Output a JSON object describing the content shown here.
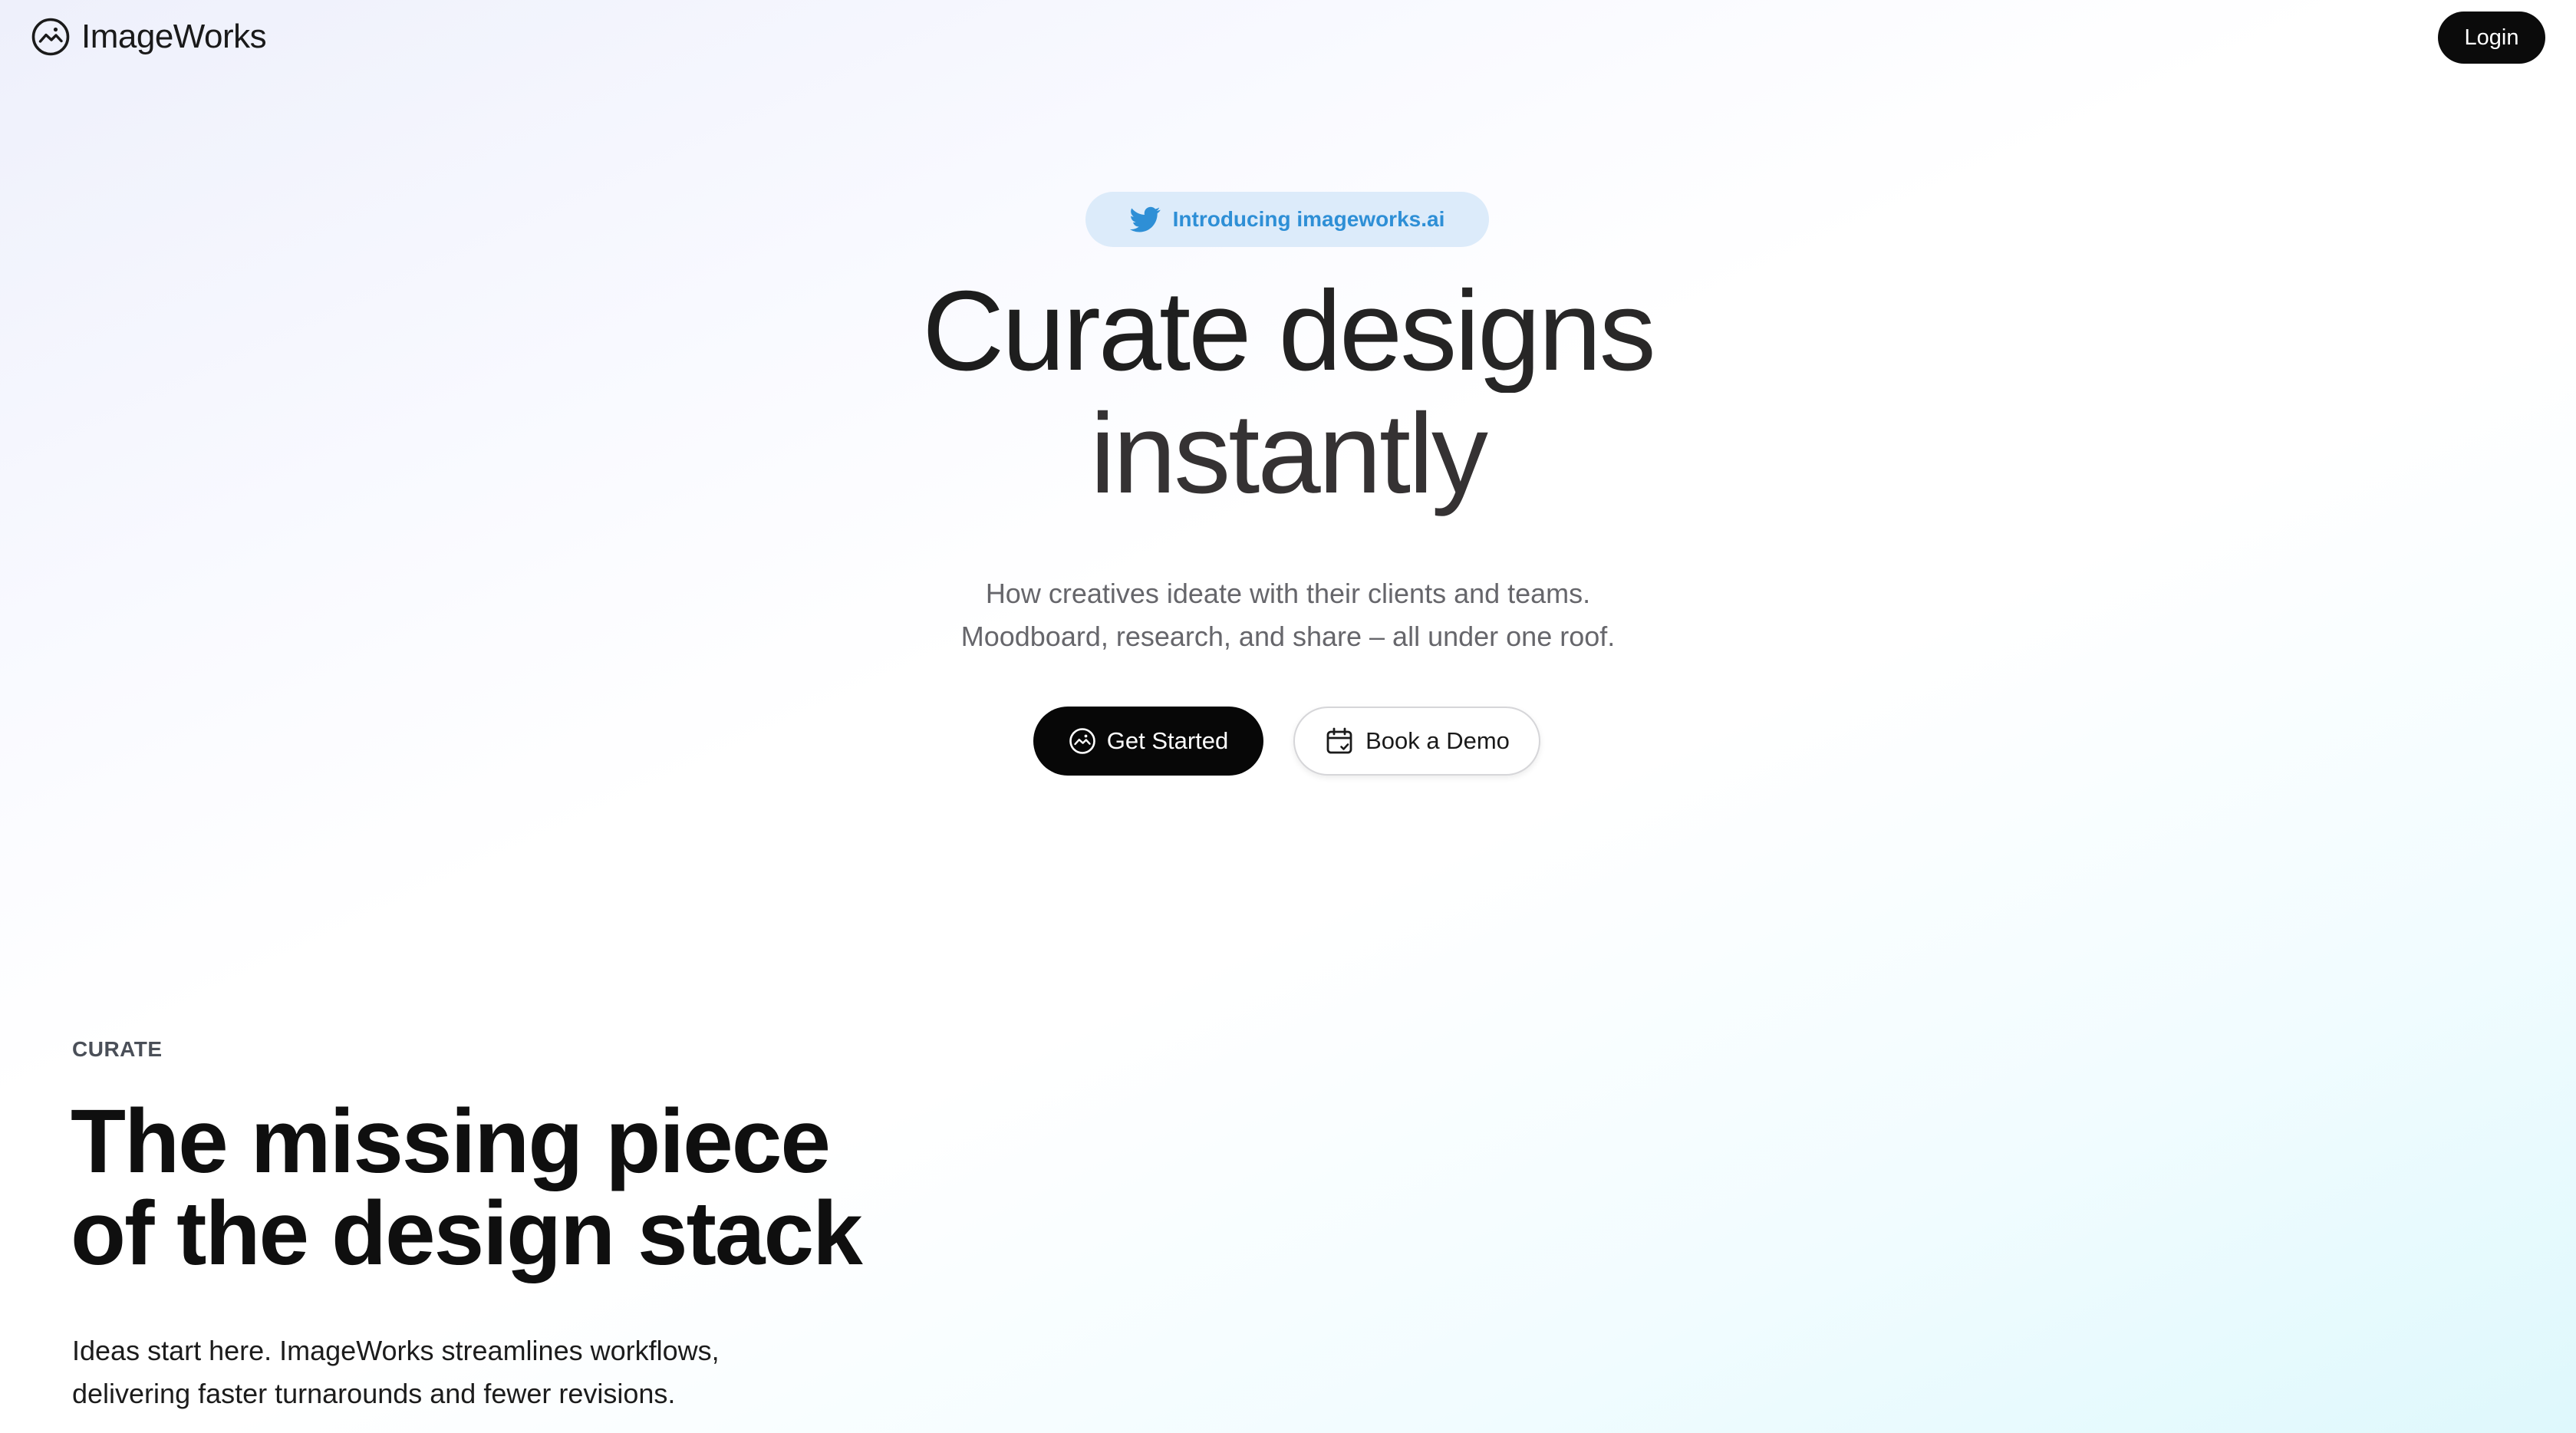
{
  "header": {
    "brand": "ImageWorks",
    "brand_icon": "image-circle-icon",
    "login_label": "Login"
  },
  "hero": {
    "announcement": {
      "icon": "twitter-bird-icon",
      "text": "Introducing imageworks.ai",
      "color": "#2e8fd6",
      "background": "#dcebfa"
    },
    "title_line1": "Curate designs",
    "title_line2": "instantly",
    "subtitle_line1": "How creatives ideate with their clients and teams.",
    "subtitle_line2": "Moodboard, research, and share – all under one roof.",
    "primary_cta": {
      "label": "Get Started",
      "icon": "image-circle-icon"
    },
    "secondary_cta": {
      "label": "Book a Demo",
      "icon": "calendar-check-icon"
    }
  },
  "curate_section": {
    "eyebrow": "CURATE",
    "title_line1": "The missing piece",
    "title_line2": "of the design stack",
    "body_line1": "Ideas start here. ImageWorks streamlines workflows,",
    "body_line2": "delivering faster turnarounds and fewer revisions."
  },
  "colors": {
    "primary_button": "#070707",
    "text_dark": "#111111",
    "text_muted": "#66666b",
    "accent_blue": "#2e8fd6",
    "background_tint_left": "#eef0fb",
    "background_tint_right": "#def8fc"
  }
}
